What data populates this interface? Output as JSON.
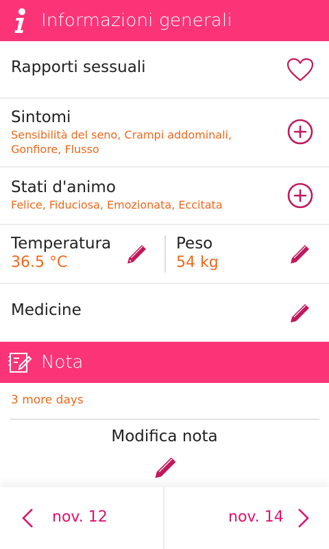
{
  "header": {
    "title": "Informazioni generali",
    "icon": "info-icon"
  },
  "rows": {
    "sex": {
      "title": "Rapporti sessuali",
      "icon": "heart-outline-icon"
    },
    "symptoms": {
      "title": "Sintomi",
      "detail": "Sensibilità del seno, Crampi addominali, Gonfiore, Flusso",
      "icon": "plus-circle-icon"
    },
    "moods": {
      "title": "Stati d'animo",
      "detail": "Felice, Fiduciosa, Emozionata, Eccitata",
      "icon": "plus-circle-icon"
    },
    "temperature": {
      "title": "Temperatura",
      "value": "36.5 °C",
      "icon": "pencil-icon"
    },
    "weight": {
      "title": "Peso",
      "value": "54 kg",
      "icon": "pencil-icon"
    },
    "medicine": {
      "title": "Medicine",
      "icon": "pencil-icon"
    }
  },
  "note": {
    "header": "Nota",
    "icon": "note-edit-icon",
    "meta": "3 more days",
    "edit_label": "Modifica nota"
  },
  "nav": {
    "prev_label": "nov. 12",
    "next_label": "nov. 14"
  },
  "colors": {
    "accent": "#fb3478",
    "icon": "#c2185b",
    "orange": "#f0681a",
    "nav_text": "#e0116e"
  }
}
